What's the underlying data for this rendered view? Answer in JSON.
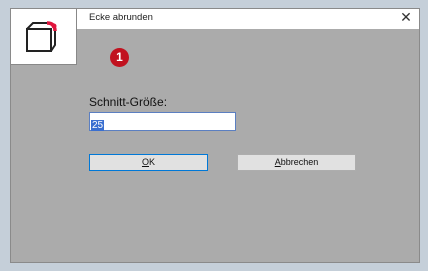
{
  "dialog": {
    "title": "Ecke abrunden",
    "close_glyph": "✕",
    "icon": "rounded-corner-icon",
    "step_badge": "1",
    "field_label": "Schnitt-Größe:",
    "size_value": "25",
    "ok_mnemonic": "O",
    "ok_rest": "K",
    "cancel_mnemonic": "A",
    "cancel_rest": "bbrechen"
  },
  "colors": {
    "badge": "#c1121f",
    "selection": "#3a6fd0",
    "dialog_bg": "#ababab",
    "corner_accent": "#e0143c"
  }
}
